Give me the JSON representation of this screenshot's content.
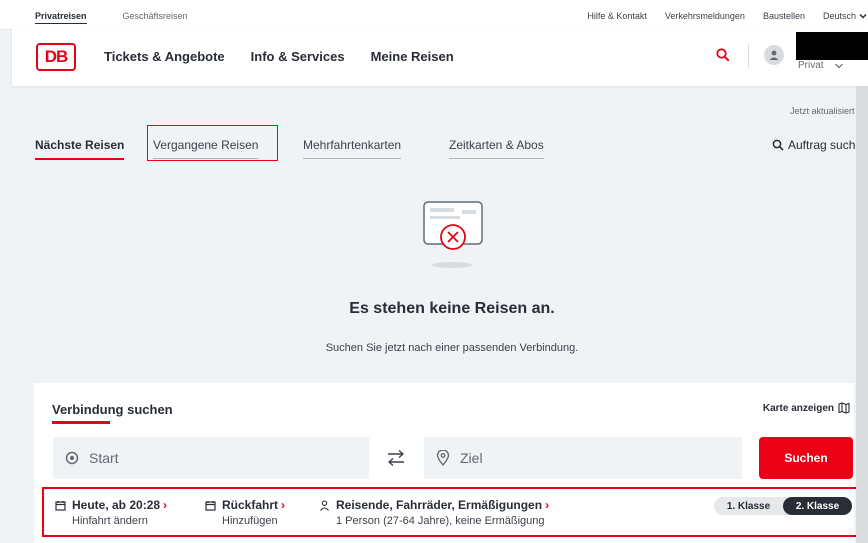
{
  "topbar": {
    "segments": [
      "Privatreisen",
      "Geschäftsreisen"
    ],
    "links": [
      "Hilfe & Kontakt",
      "Verkehrsmeldungen",
      "Baustellen",
      "Deutsch"
    ]
  },
  "header": {
    "logo": "DB",
    "nav": [
      "Tickets & Angebote",
      "Info & Services",
      "Meine Reisen"
    ],
    "account_type": "Privat"
  },
  "updated_text": "Jetzt aktualisiert",
  "tabs": [
    "Nächste Reisen",
    "Vergangene Reisen",
    "Mehrfahrtenkarten",
    "Zeitkarten & Abos"
  ],
  "auftrag_label": "Auftrag suchen",
  "empty": {
    "title": "Es stehen keine Reisen an.",
    "subtitle": "Suchen Sie jetzt nach einer passenden Verbindung."
  },
  "search_panel": {
    "title": "Verbindung suchen",
    "map_link": "Karte anzeigen",
    "start_placeholder": "Start",
    "ziel_placeholder": "Ziel",
    "search_button": "Suchen",
    "options": [
      {
        "main": "Heute, ab 20:28",
        "sub": "Hinfahrt ändern",
        "icon": "calendar-icon"
      },
      {
        "main": "Rückfahrt",
        "sub": "Hinzufügen",
        "icon": "calendar-icon"
      },
      {
        "main": "Reisende, Fahrräder, Ermäßigungen",
        "sub": "1 Person (27-64 Jahre), keine Ermäßigung",
        "icon": "person-icon"
      }
    ],
    "klasse": [
      "1. Klasse",
      "2. Klasse"
    ],
    "selected_klasse": "2. Klasse"
  },
  "colors": {
    "accent": "#ec0016",
    "text": "#282d37",
    "background": "#f0f3f5"
  }
}
